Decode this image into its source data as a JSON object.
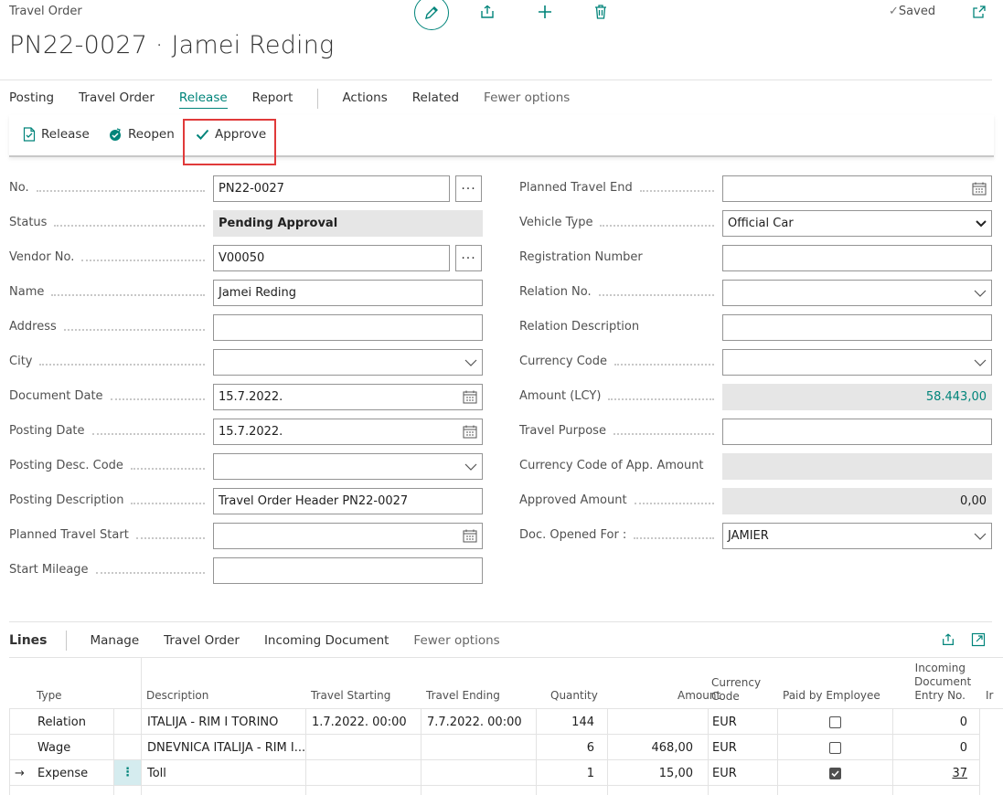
{
  "header": {
    "crumb": "Travel Order",
    "title": "PN22-0027 · Jamei Reding",
    "saved": "Saved"
  },
  "tabs": [
    {
      "label": "Posting"
    },
    {
      "label": "Travel Order"
    },
    {
      "label": "Release",
      "active": true
    },
    {
      "label": "Report"
    },
    {
      "label": "Actions"
    },
    {
      "label": "Related"
    },
    {
      "label": "Fewer options"
    }
  ],
  "actions": {
    "release": "Release",
    "reopen": "Reopen",
    "approve": "Approve"
  },
  "left_fields": {
    "no": {
      "label": "No.",
      "value": "PN22-0027"
    },
    "status": {
      "label": "Status",
      "value": "Pending Approval"
    },
    "vendor_no": {
      "label": "Vendor No.",
      "value": "V00050"
    },
    "name": {
      "label": "Name",
      "value": "Jamei Reding"
    },
    "address": {
      "label": "Address",
      "value": ""
    },
    "city": {
      "label": "City",
      "value": ""
    },
    "document_date": {
      "label": "Document Date",
      "value": "15.7.2022."
    },
    "posting_date": {
      "label": "Posting Date",
      "value": "15.7.2022."
    },
    "posting_desc_code": {
      "label": "Posting Desc. Code",
      "value": ""
    },
    "posting_description": {
      "label": "Posting Description",
      "value": "Travel Order Header PN22-0027"
    },
    "planned_travel_start": {
      "label": "Planned Travel Start",
      "value": ""
    },
    "start_mileage": {
      "label": "Start Mileage",
      "value": ""
    }
  },
  "right_fields": {
    "planned_travel_end": {
      "label": "Planned Travel End",
      "value": ""
    },
    "vehicle_type": {
      "label": "Vehicle Type",
      "value": "Official Car"
    },
    "registration_number": {
      "label": "Registration Number",
      "value": ""
    },
    "relation_no": {
      "label": "Relation No.",
      "value": ""
    },
    "relation_description": {
      "label": "Relation Description",
      "value": ""
    },
    "currency_code": {
      "label": "Currency Code",
      "value": ""
    },
    "amount_lcy": {
      "label": "Amount (LCY)",
      "value": "58.443,00"
    },
    "travel_purpose": {
      "label": "Travel Purpose",
      "value": ""
    },
    "currency_code_app": {
      "label": "Currency Code of App. Amount",
      "value": ""
    },
    "approved_amount": {
      "label": "Approved Amount",
      "value": "0,00"
    },
    "doc_opened_for": {
      "label": "Doc. Opened For :",
      "value": "JAMIER"
    }
  },
  "lines": {
    "title": "Lines",
    "menu": [
      "Manage",
      "Travel Order",
      "Incoming Document",
      "Fewer options"
    ],
    "columns": {
      "type": "Type",
      "description": "Description",
      "travel_starting": "Travel Starting",
      "travel_ending": "Travel Ending",
      "quantity": "Quantity",
      "amount": "Amount",
      "currency_code_1": "Currency",
      "currency_code_2": "Code",
      "paid_by_employee": "Paid by Employee",
      "incoming_1": "Incoming",
      "incoming_2": "Document",
      "incoming_3": "Entry No.",
      "trunc": "Ir"
    },
    "rows": [
      {
        "type": "Relation",
        "description": "ITALIJA - RIM I TORINO",
        "travel_starting": "1.7.2022. 00:00",
        "travel_ending": "7.7.2022. 00:00",
        "quantity": "144",
        "amount": "",
        "currency": "EUR",
        "paid": false,
        "entry_no": "0"
      },
      {
        "type": "Wage",
        "description": "DNEVNICA ITALIJA - RIM I...",
        "travel_starting": "",
        "travel_ending": "",
        "quantity": "6",
        "amount": "468,00",
        "currency": "EUR",
        "paid": false,
        "entry_no": "0"
      },
      {
        "type": "Expense",
        "description": "Toll",
        "travel_starting": "",
        "travel_ending": "",
        "quantity": "1",
        "amount": "15,00",
        "currency": "EUR",
        "paid": true,
        "entry_no": "37",
        "selected": true
      }
    ]
  },
  "colors": {
    "accent": "#00847a",
    "highlight": "#e03a3a"
  }
}
